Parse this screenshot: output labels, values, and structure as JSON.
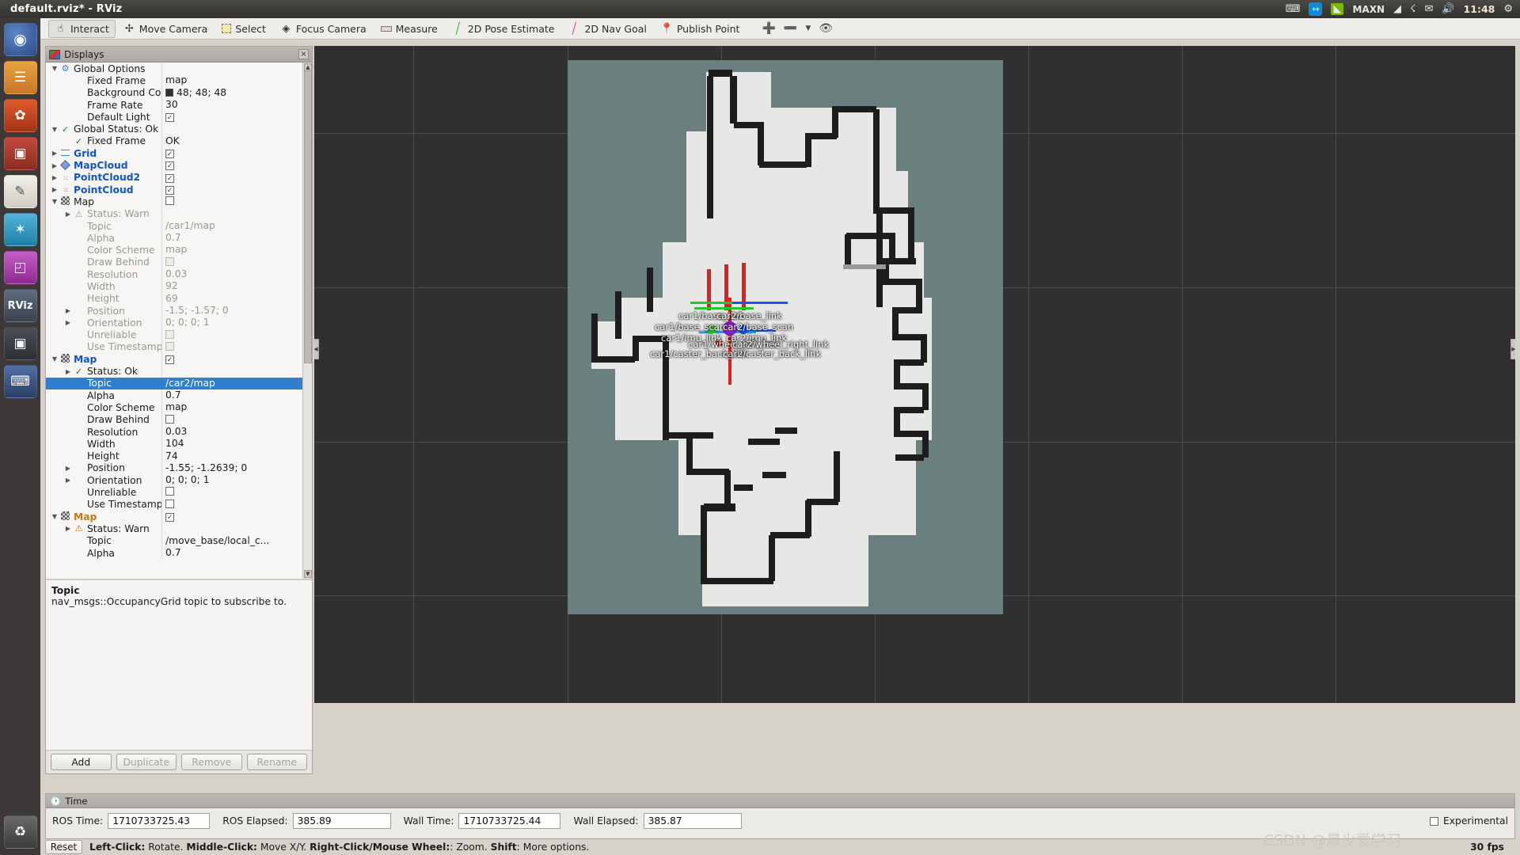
{
  "window": {
    "title": "default.rviz* - RViz"
  },
  "systray": {
    "icons": [
      "keyboard-icon",
      "teamviewer-icon",
      "nvidia-icon",
      "wifi-icon",
      "bluetooth-icon",
      "mail-icon",
      "volume-icon",
      "power-icon"
    ],
    "nvidia_label": "MAXN",
    "clock": "11:48"
  },
  "launcher": {
    "items": [
      {
        "name": "dash-icon",
        "glyph": "◎"
      },
      {
        "name": "files-icon",
        "glyph": "☰"
      },
      {
        "name": "firefox-icon",
        "glyph": "✿"
      },
      {
        "name": "app-red-icon",
        "glyph": "▣"
      },
      {
        "name": "text-editor-icon",
        "glyph": "✎"
      },
      {
        "name": "software-center-icon",
        "glyph": "✦"
      },
      {
        "name": "app-pink-icon",
        "glyph": "◰"
      },
      {
        "name": "rviz-icon",
        "glyph": "RViz"
      },
      {
        "name": "camera-icon",
        "glyph": "□"
      },
      {
        "name": "terminal-icon",
        "glyph": "⌨"
      },
      {
        "name": "trash-icon",
        "glyph": "♻"
      }
    ]
  },
  "toolbar": {
    "buttons": [
      {
        "label": "Interact",
        "icon": "hand-icon",
        "active": true
      },
      {
        "label": "Move Camera",
        "icon": "move-camera-icon",
        "active": false
      },
      {
        "label": "Select",
        "icon": "select-icon",
        "active": false
      },
      {
        "label": "Focus Camera",
        "icon": "focus-camera-icon",
        "active": false
      },
      {
        "label": "Measure",
        "icon": "measure-icon",
        "active": false
      },
      {
        "label": "2D Pose Estimate",
        "icon": "pose-estimate-icon",
        "active": false
      },
      {
        "label": "2D Nav Goal",
        "icon": "nav-goal-icon",
        "active": false
      },
      {
        "label": "Publish Point",
        "icon": "publish-point-icon",
        "active": false
      }
    ],
    "extra_icons": [
      "add-tool-icon",
      "remove-tool-icon",
      "tool-dropdown-icon",
      "eye-icon"
    ]
  },
  "displays": {
    "panel_title": "Displays",
    "close_label": "×",
    "rows": [
      {
        "indent": 0,
        "arrow": "open",
        "icon": "gear-icon",
        "label": "Global Options",
        "value": "",
        "style": "plain"
      },
      {
        "indent": 1,
        "arrow": "none",
        "icon": "",
        "label": "Fixed Frame",
        "value": "map",
        "style": "plain"
      },
      {
        "indent": 1,
        "arrow": "none",
        "icon": "",
        "label": "Background Color",
        "value": "48; 48; 48",
        "style": "swatch"
      },
      {
        "indent": 1,
        "arrow": "none",
        "icon": "",
        "label": "Frame Rate",
        "value": "30",
        "style": "plain"
      },
      {
        "indent": 1,
        "arrow": "none",
        "icon": "",
        "label": "Default Light",
        "value": "",
        "style": "check"
      },
      {
        "indent": 0,
        "arrow": "open",
        "icon": "check-icon",
        "label": "Global Status: Ok",
        "value": "",
        "style": "plain"
      },
      {
        "indent": 1,
        "arrow": "none",
        "icon": "check-icon",
        "label": "Fixed Frame",
        "value": "OK",
        "style": "plain"
      },
      {
        "indent": 0,
        "arrow": "closed",
        "icon": "grid-icon",
        "label": "Grid",
        "value": "",
        "style": "check-bold"
      },
      {
        "indent": 0,
        "arrow": "closed",
        "icon": "mapcloud-icon",
        "label": "MapCloud",
        "value": "",
        "style": "check-bold"
      },
      {
        "indent": 0,
        "arrow": "closed",
        "icon": "pointcloud2-icon",
        "label": "PointCloud2",
        "value": "",
        "style": "check-bold"
      },
      {
        "indent": 0,
        "arrow": "closed",
        "icon": "pointcloud-icon",
        "label": "PointCloud",
        "value": "",
        "style": "check-bold"
      },
      {
        "indent": 0,
        "arrow": "open",
        "icon": "map-icon",
        "label": "Map",
        "value": "",
        "style": "uncheck-plain"
      },
      {
        "indent": 1,
        "arrow": "closed",
        "icon": "warn-icon",
        "label": "Status: Warn",
        "value": "",
        "style": "disabled"
      },
      {
        "indent": 1,
        "arrow": "none",
        "icon": "",
        "label": "Topic",
        "value": "/car1/map",
        "style": "disabled"
      },
      {
        "indent": 1,
        "arrow": "none",
        "icon": "",
        "label": "Alpha",
        "value": "0.7",
        "style": "disabled"
      },
      {
        "indent": 1,
        "arrow": "none",
        "icon": "",
        "label": "Color Scheme",
        "value": "map",
        "style": "disabled"
      },
      {
        "indent": 1,
        "arrow": "none",
        "icon": "",
        "label": "Draw Behind",
        "value": "",
        "style": "check-dis"
      },
      {
        "indent": 1,
        "arrow": "none",
        "icon": "",
        "label": "Resolution",
        "value": "0.03",
        "style": "disabled"
      },
      {
        "indent": 1,
        "arrow": "none",
        "icon": "",
        "label": "Width",
        "value": "92",
        "style": "disabled"
      },
      {
        "indent": 1,
        "arrow": "none",
        "icon": "",
        "label": "Height",
        "value": "69",
        "style": "disabled"
      },
      {
        "indent": 1,
        "arrow": "closed",
        "icon": "",
        "label": "Position",
        "value": "-1.5; -1.57; 0",
        "style": "disabled"
      },
      {
        "indent": 1,
        "arrow": "closed",
        "icon": "",
        "label": "Orientation",
        "value": "0; 0; 0; 1",
        "style": "disabled"
      },
      {
        "indent": 1,
        "arrow": "none",
        "icon": "",
        "label": "Unreliable",
        "value": "",
        "style": "check-dis"
      },
      {
        "indent": 1,
        "arrow": "none",
        "icon": "",
        "label": "Use Timestamp",
        "value": "",
        "style": "check-dis"
      },
      {
        "indent": 0,
        "arrow": "open",
        "icon": "map-icon",
        "label": "Map",
        "value": "",
        "style": "check-bold"
      },
      {
        "indent": 1,
        "arrow": "closed",
        "icon": "check-icon",
        "label": "Status: Ok",
        "value": "",
        "style": "plain"
      },
      {
        "indent": 1,
        "arrow": "none",
        "icon": "",
        "label": "Topic",
        "value": "/car2/map",
        "style": "selected"
      },
      {
        "indent": 1,
        "arrow": "none",
        "icon": "",
        "label": "Alpha",
        "value": "0.7",
        "style": "plain"
      },
      {
        "indent": 1,
        "arrow": "none",
        "icon": "",
        "label": "Color Scheme",
        "value": "map",
        "style": "plain"
      },
      {
        "indent": 1,
        "arrow": "none",
        "icon": "",
        "label": "Draw Behind",
        "value": "",
        "style": "check-off"
      },
      {
        "indent": 1,
        "arrow": "none",
        "icon": "",
        "label": "Resolution",
        "value": "0.03",
        "style": "plain"
      },
      {
        "indent": 1,
        "arrow": "none",
        "icon": "",
        "label": "Width",
        "value": "104",
        "style": "plain"
      },
      {
        "indent": 1,
        "arrow": "none",
        "icon": "",
        "label": "Height",
        "value": "74",
        "style": "plain"
      },
      {
        "indent": 1,
        "arrow": "closed",
        "icon": "",
        "label": "Position",
        "value": "-1.55; -1.2639; 0",
        "style": "plain"
      },
      {
        "indent": 1,
        "arrow": "closed",
        "icon": "",
        "label": "Orientation",
        "value": "0; 0; 0; 1",
        "style": "plain"
      },
      {
        "indent": 1,
        "arrow": "none",
        "icon": "",
        "label": "Unreliable",
        "value": "",
        "style": "check-off"
      },
      {
        "indent": 1,
        "arrow": "none",
        "icon": "",
        "label": "Use Timestamp",
        "value": "",
        "style": "check-off"
      },
      {
        "indent": 0,
        "arrow": "open",
        "icon": "map-icon",
        "label": "Map",
        "value": "",
        "style": "check-warn"
      },
      {
        "indent": 1,
        "arrow": "closed",
        "icon": "warn-icon",
        "label": "Status: Warn",
        "value": "",
        "style": "plain"
      },
      {
        "indent": 1,
        "arrow": "none",
        "icon": "",
        "label": "Topic",
        "value": "/move_base/local_c...",
        "style": "plain"
      },
      {
        "indent": 1,
        "arrow": "none",
        "icon": "",
        "label": "Alpha",
        "value": "0.7",
        "style": "plain"
      }
    ],
    "description": {
      "title": "Topic",
      "text": "nav_msgs::OccupancyGrid topic to subscribe to."
    },
    "buttons": [
      {
        "label": "Add",
        "enabled": true
      },
      {
        "label": "Duplicate",
        "enabled": false
      },
      {
        "label": "Remove",
        "enabled": false
      },
      {
        "label": "Rename",
        "enabled": false
      }
    ]
  },
  "view3d": {
    "frame_labels": [
      "car1/base_link",
      "car1/base_scan",
      "car2/base_link",
      "car2/base_scan",
      "car1/imu_link",
      "car2/imu_link",
      "car1/caster_back_link",
      "car2/caster_back_link",
      "car1/wheel_left_link",
      "car2/wheel_right_link"
    ],
    "background_color": "#303030",
    "map_color": "#69807e"
  },
  "time": {
    "panel_title": "Time",
    "fields": [
      {
        "label": "ROS Time:",
        "value": "1710733725.43"
      },
      {
        "label": "ROS Elapsed:",
        "value": "385.89"
      },
      {
        "label": "Wall Time:",
        "value": "1710733725.44"
      },
      {
        "label": "Wall Elapsed:",
        "value": "385.87"
      }
    ],
    "experimental_label": "Experimental"
  },
  "statusbar": {
    "reset_label": "Reset",
    "hint_parts": [
      {
        "text": "Left-Click:",
        "bold": true
      },
      {
        "text": " Rotate.  ",
        "bold": false
      },
      {
        "text": "Middle-Click:",
        "bold": true
      },
      {
        "text": " Move X/Y.  ",
        "bold": false
      },
      {
        "text": "Right-Click/Mouse Wheel:",
        "bold": true
      },
      {
        "text": ": Zoom.  ",
        "bold": false
      },
      {
        "text": "Shift",
        "bold": true
      },
      {
        "text": ": More options.",
        "bold": false
      }
    ],
    "fps": "30 fps",
    "watermark": "CSDN @晨少爱学习"
  }
}
